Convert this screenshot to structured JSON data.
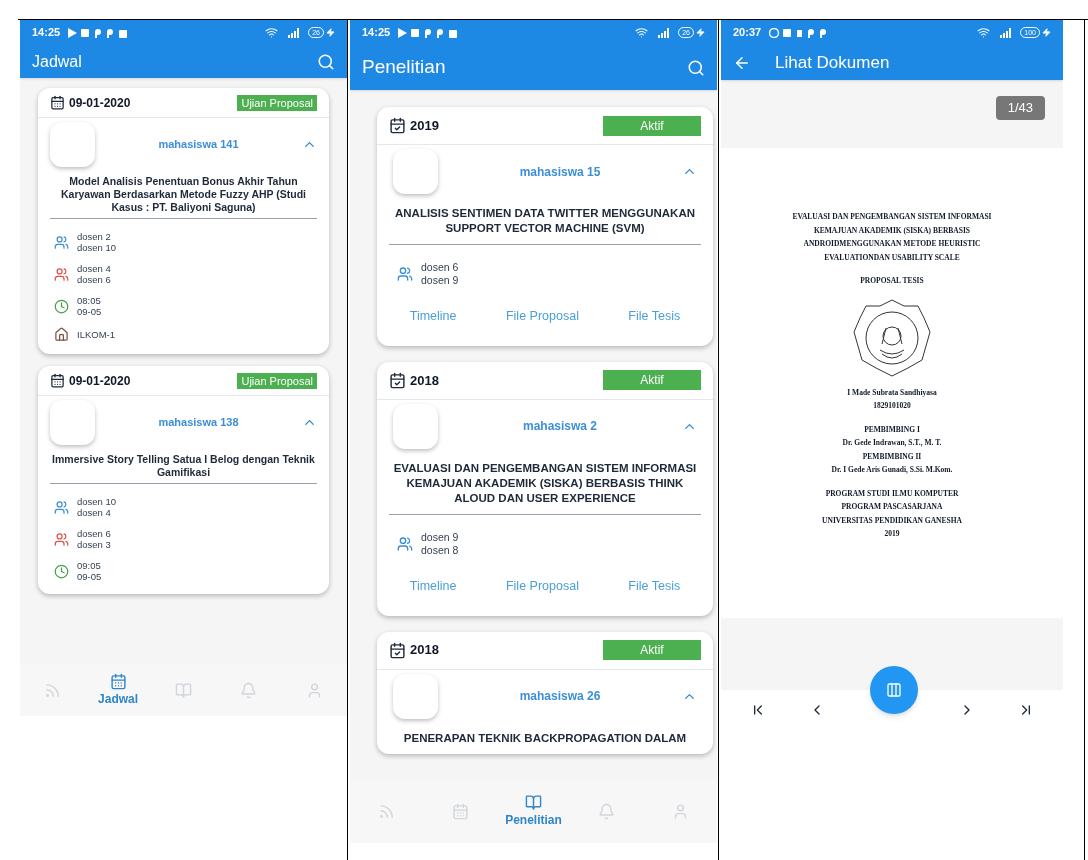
{
  "screens": [
    {
      "kind": "jadwal",
      "status_bar": {
        "time": "14:25",
        "battery": "26"
      },
      "app_bar": {
        "title": "Jadwal"
      },
      "cards": [
        {
          "date": "09-01-2020",
          "badge": "Ujian Proposal",
          "student": "mahasiswa 141",
          "expanded": true,
          "title": "Model Analisis Penentuan Bonus Akhir Tahun Karyawan Berdasarkan Metode Fuzzy AHP (Studi Kasus : PT. Baliyoni Saguna)",
          "rows": [
            {
              "kind": "supervisors",
              "lines": [
                "dosen 2",
                "dosen 10"
              ]
            },
            {
              "kind": "examiners",
              "lines": [
                "dosen 4",
                "dosen 6"
              ]
            },
            {
              "kind": "time",
              "lines": [
                "08:05",
                "09-05"
              ]
            },
            {
              "kind": "room",
              "lines": [
                "ILKOM-1"
              ]
            }
          ]
        },
        {
          "date": "09-01-2020",
          "badge": "Ujian Proposal",
          "student": "mahasiswa 138",
          "expanded": true,
          "title": "Immersive Story Telling Satua I Belog dengan Teknik Gamifikasi",
          "rows": [
            {
              "kind": "supervisors",
              "lines": [
                "dosen 10",
                "dosen 4"
              ]
            },
            {
              "kind": "examiners",
              "lines": [
                "dosen 6",
                "dosen 3"
              ]
            },
            {
              "kind": "time",
              "lines": [
                "09:05",
                "09-05"
              ]
            }
          ]
        }
      ],
      "bottom_nav": [
        {
          "kind": "feed",
          "selected": false
        },
        {
          "kind": "calendar",
          "selected": true,
          "label": "Jadwal"
        },
        {
          "kind": "book",
          "selected": false
        },
        {
          "kind": "bell",
          "selected": false
        },
        {
          "kind": "person",
          "selected": false
        }
      ]
    },
    {
      "kind": "penelitian",
      "status_bar": {
        "time": "14:25",
        "battery": "26"
      },
      "app_bar": {
        "title": "Penelitian"
      },
      "cards": [
        {
          "year": "2019",
          "status": "Aktif",
          "student": "mahasiswa 15",
          "expanded": true,
          "title": "ANALISIS SENTIMEN DATA TWITTER  MENGGUNAKAN SUPPORT VECTOR MACHINE (SVM)",
          "supervisors": [
            "dosen 6",
            "dosen 9"
          ],
          "links": [
            "Timeline",
            "File Proposal",
            "File Tesis"
          ]
        },
        {
          "year": "2018",
          "status": "Aktif",
          "student": "mahasiswa 2",
          "expanded": true,
          "title": "EVALUASI DAN PENGEMBANGAN SISTEM INFORMASI KEMAJUAN AKADEMIK (SISKA) BERBASIS THINK ALOUD DAN USER EXPERIENCE",
          "supervisors": [
            "dosen 9",
            "dosen 8"
          ],
          "links": [
            "Timeline",
            "File Proposal",
            "File Tesis"
          ]
        },
        {
          "year": "2018",
          "status": "Aktif",
          "student": "mahasiswa 26",
          "expanded": true,
          "title": "PENERAPAN TEKNIK BACKPROPAGATION  DALAM"
        }
      ],
      "bottom_nav": [
        {
          "kind": "feed",
          "selected": false
        },
        {
          "kind": "calendar",
          "selected": false
        },
        {
          "kind": "book",
          "selected": true,
          "label": "Penelitian"
        },
        {
          "kind": "bell",
          "selected": false
        },
        {
          "kind": "person",
          "selected": false
        }
      ]
    },
    {
      "kind": "dokumen",
      "status_bar": {
        "time": "20:37",
        "battery": "100"
      },
      "app_bar": {
        "title": "Lihat Dokumen"
      },
      "page_indicator": "1/43",
      "document": {
        "title_lines": [
          "EVALUASI DAN PENGEMBANGAN SISTEM INFORMASI",
          "KEMAJUAN AKADEMIK (SISKA) BERBASIS",
          "ANDROIDMENGGUNAKAN METODE HEURISTIC",
          "EVALUATIONDAN USABILITY SCALE"
        ],
        "subtitle": "PROPOSAL TESIS",
        "author": [
          "I Made Subrata Sandhiyasa",
          "1829101020"
        ],
        "supervisors": [
          "PEMBIMBING I",
          "Dr. Gede Indrawan, S.T., M. T.",
          "PEMBIMBING II",
          "Dr. I Gede Aris Gunadi, S.Si. M.Kom."
        ],
        "institution": [
          "PROGRAM STUDI ILMU KOMPUTER",
          "PROGRAM PASCASARJANA",
          "UNIVERSITAS PENDIDIKAN GANESHA",
          "2019"
        ]
      }
    }
  ]
}
